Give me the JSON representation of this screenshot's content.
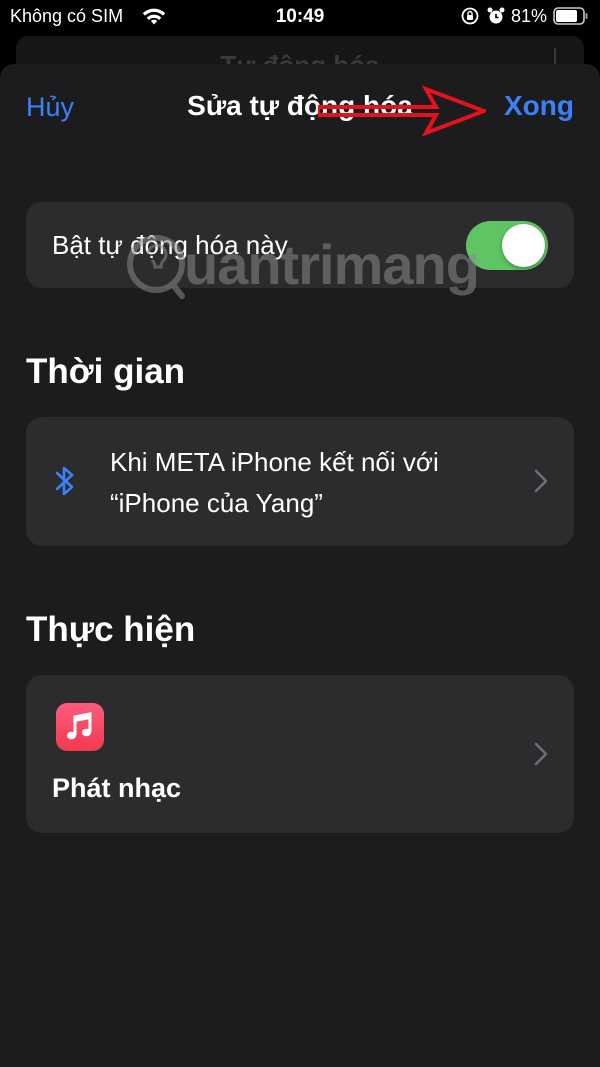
{
  "status_bar": {
    "carrier": "Không có SIM",
    "time": "10:49",
    "battery": "81%"
  },
  "background_sheet": {
    "title": "Tự động hóa"
  },
  "nav": {
    "cancel_label": "Hủy",
    "title": "Sửa tự động hóa",
    "done_label": "Xong"
  },
  "toggle_row": {
    "label": "Bật tự động hóa này",
    "enabled": true
  },
  "sections": {
    "time_title": "Thời gian",
    "action_title": "Thực hiện"
  },
  "trigger": {
    "line1": "Khi META iPhone kết nối với",
    "line2": "“iPhone của Yang”",
    "icon": "bluetooth-icon"
  },
  "action": {
    "label": "Phát nhạc",
    "icon": "music-icon"
  },
  "watermark": {
    "text": "uantrimang"
  },
  "colors": {
    "accent": "#3b82f6",
    "toggle_on": "#5fc463",
    "card": "#2c2c2e",
    "sheet": "#1c1c1e",
    "arrow": "#e3121b"
  }
}
